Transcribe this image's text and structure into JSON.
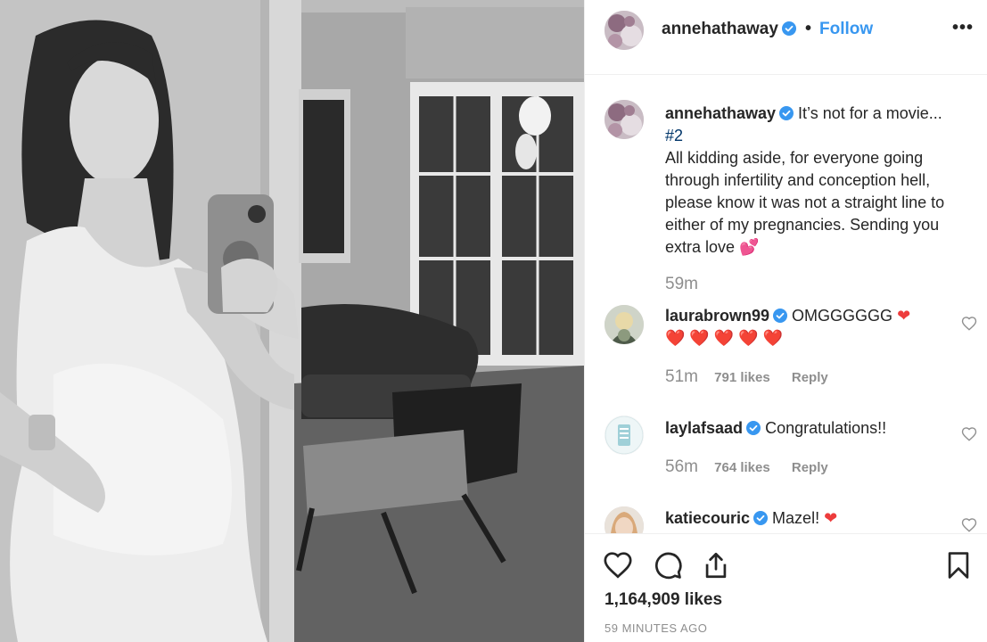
{
  "post": {
    "username": "annehathaway",
    "follow_label": "Follow",
    "separator": "•",
    "more_label": "•••",
    "likes": "1,164,909 likes",
    "timestamp": "59 MINUTES AGO"
  },
  "caption": {
    "username": "annehathaway",
    "text_line1": " It’s not for a movie...",
    "hashtag": "#2",
    "text_rest": "All kidding aside, for everyone going through infertility and conception hell, please know it was not a straight line to either of my pregnancies. Sending you extra love ",
    "emoji": "💕",
    "time": "59m"
  },
  "comments": [
    {
      "username": "laurabrown99",
      "text": " OMGGGGGG ",
      "hearts_inline": "❤",
      "hearts_line2": "❤️ ❤️ ❤️ ❤️ ❤️",
      "time": "51m",
      "likes": "791 likes",
      "reply": "Reply"
    },
    {
      "username": "laylafsaad",
      "text": " Congratulations!!",
      "time": "56m",
      "likes": "764 likes",
      "reply": "Reply"
    },
    {
      "username": "katiecouric",
      "text": " Mazel! ",
      "hearts_inline": "❤"
    }
  ],
  "icons": {
    "like": "heart-outline-icon",
    "comment": "comment-icon",
    "share": "share-icon",
    "save": "bookmark-icon",
    "verified": "verified-badge-icon"
  },
  "colors": {
    "link_blue": "#3897f0",
    "verified_blue": "#3897f0",
    "meta_gray": "#8e8e8e",
    "heart_red": "#ed3c3c"
  }
}
